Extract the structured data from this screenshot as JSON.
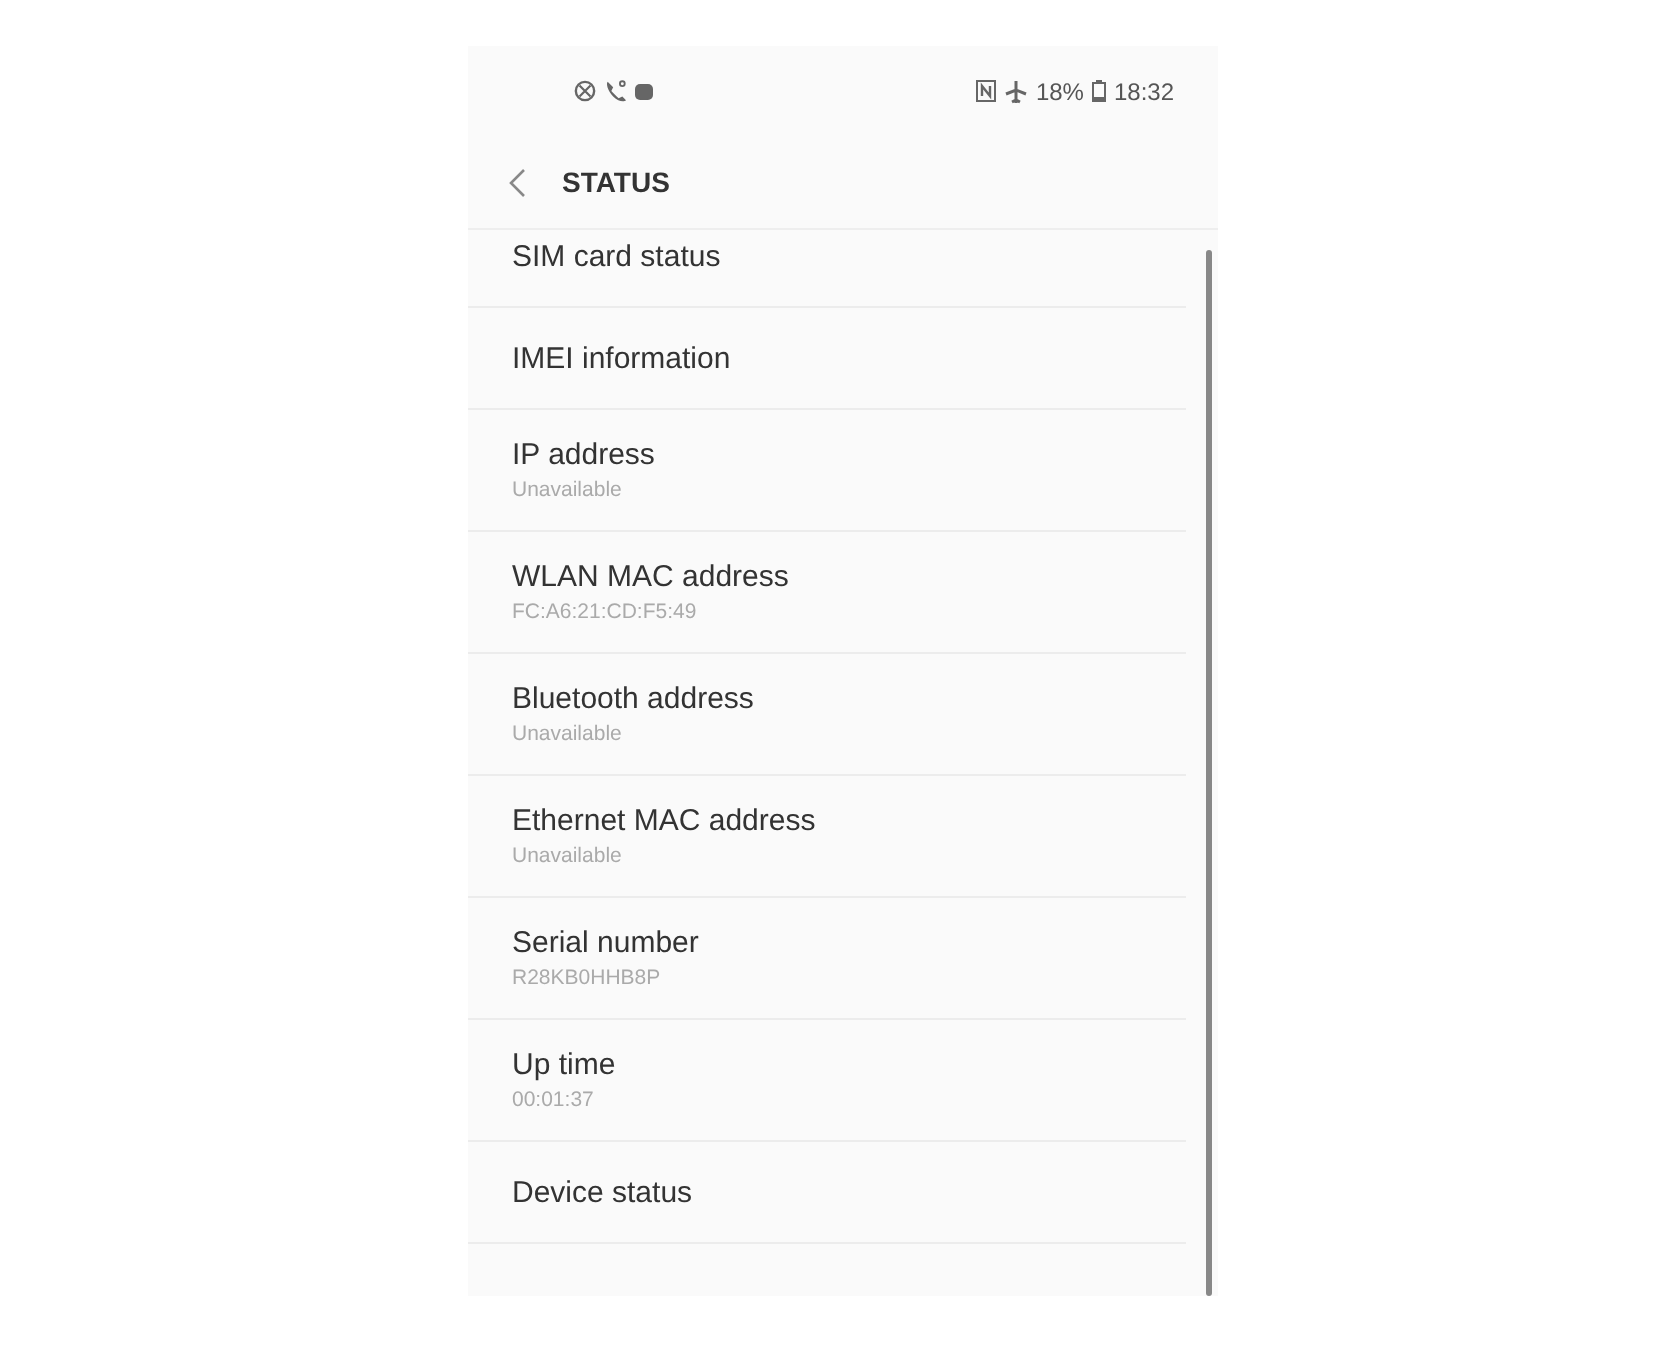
{
  "status_bar": {
    "battery": "18%",
    "time": "18:32"
  },
  "toolbar": {
    "title": "STATUS"
  },
  "items": [
    {
      "title": "SIM card status"
    },
    {
      "title": "IMEI information"
    },
    {
      "title": "IP address",
      "summary": "Unavailable"
    },
    {
      "title": "WLAN MAC address",
      "summary": "FC:A6:21:CD:F5:49"
    },
    {
      "title": "Bluetooth address",
      "summary": "Unavailable"
    },
    {
      "title": "Ethernet MAC address",
      "summary": "Unavailable"
    },
    {
      "title": "Serial number",
      "summary": "R28KB0HHB8P"
    },
    {
      "title": "Up time",
      "summary": "00:01:37"
    },
    {
      "title": "Device status"
    }
  ]
}
